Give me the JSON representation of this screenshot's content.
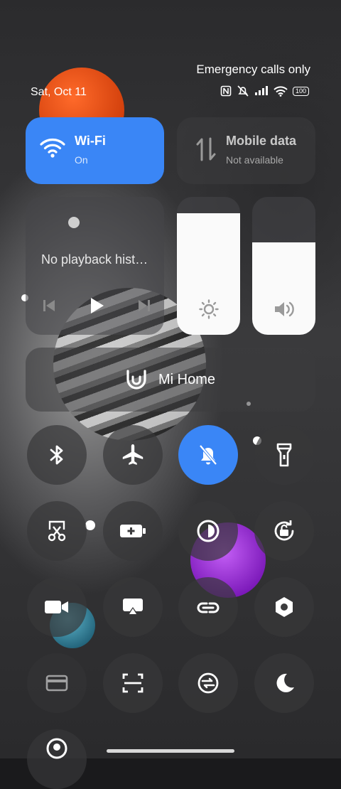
{
  "status": {
    "carrier": "Emergency calls only",
    "date": "Sat, Oct 11",
    "battery": "100"
  },
  "wifi": {
    "title": "Wi-Fi",
    "status": "On"
  },
  "mobile_data": {
    "title": "Mobile data",
    "status": "Not available"
  },
  "media": {
    "text": "No playback hist…"
  },
  "sliders": {
    "brightness_level": 0.88,
    "volume_level": 0.67
  },
  "mi_home": {
    "label": "Mi Home"
  },
  "colors": {
    "accent": "#3a86f6",
    "tile": "#3c3c3e"
  }
}
